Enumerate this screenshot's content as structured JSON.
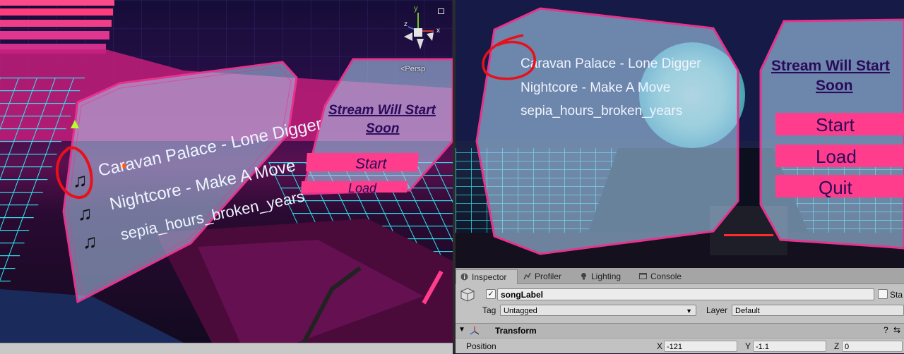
{
  "scene": {
    "persp_label": "<Persp",
    "gizmo_axes": {
      "y": "y",
      "x": "x",
      "z": "z"
    },
    "song_list": [
      "Caravan Palace - Lone Digger",
      "Nightcore - Make A Move",
      "sepia_hours_broken_years"
    ],
    "menu": {
      "title_line1": "Stream Will Start",
      "title_line2": "Soon",
      "start": "Start",
      "load": "Load"
    },
    "icons": [
      "music-note-icon",
      "gizmo-icon",
      "lock-icon"
    ]
  },
  "game": {
    "song_list": [
      "Caravan Palace - Lone Digger",
      "Nightcore - Make A Move",
      "sepia_hours_broken_years"
    ],
    "menu": {
      "title_line1": "Stream Will Start",
      "title_line2": "Soon",
      "start": "Start",
      "load": "Load",
      "quit": "Quit"
    }
  },
  "inspector": {
    "tabs": [
      {
        "label": "Inspector",
        "icon": "info-icon"
      },
      {
        "label": "Profiler",
        "icon": "profiler-icon"
      },
      {
        "label": "Lighting",
        "icon": "bulb-icon"
      },
      {
        "label": "Console",
        "icon": "console-icon"
      }
    ],
    "object_name": "songLabel",
    "static_label": "Sta",
    "tag_label": "Tag",
    "tag_value": "Untagged",
    "layer_label": "Layer",
    "layer_value": "Default",
    "component_title": "Transform",
    "position_label": "Position",
    "position": {
      "x_label": "X",
      "x": "-121",
      "y_label": "Y",
      "y": "-1.1",
      "z_label": "Z",
      "z": "0"
    }
  },
  "colors": {
    "accent_pink": "#ff3d8c",
    "neon_cyan": "#28e8f0",
    "panel_glass": "#a8c8ee",
    "annotation_red": "#e8101a",
    "menu_text": "#2a0a5a"
  }
}
